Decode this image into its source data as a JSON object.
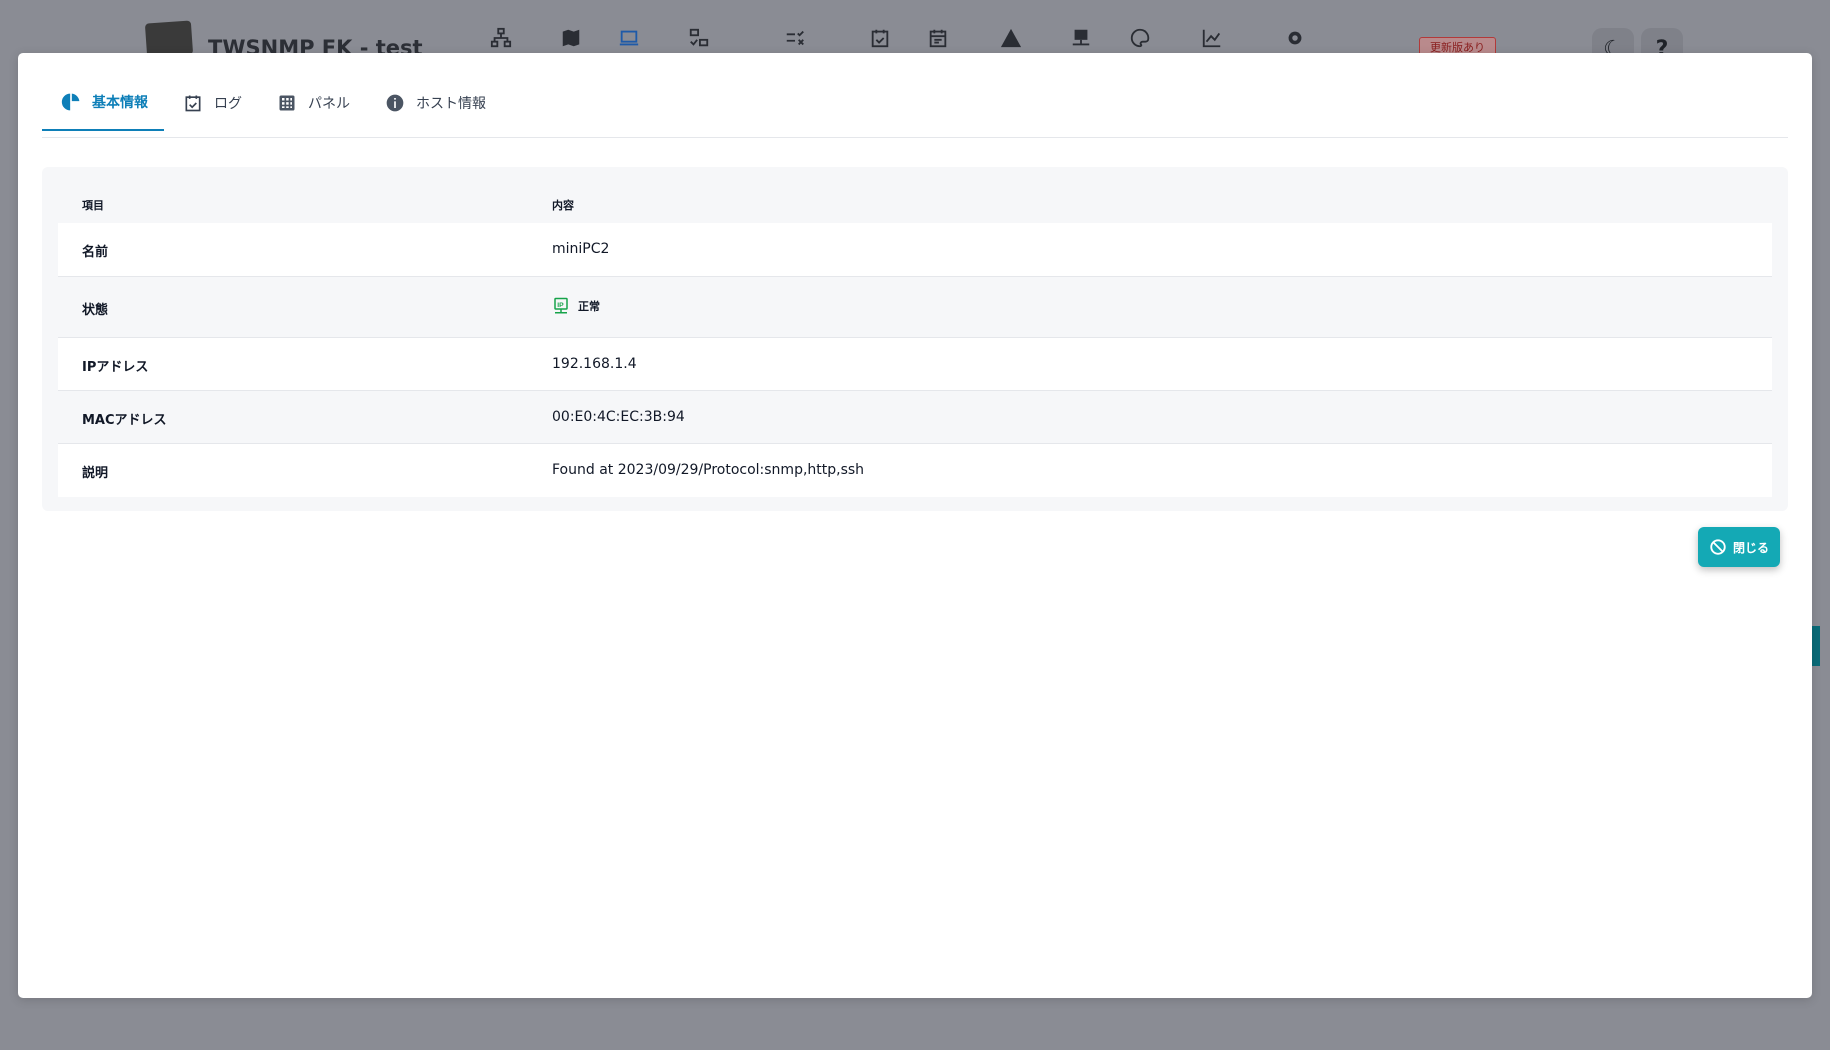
{
  "app": {
    "title": "TWSNMP FK - test",
    "update_badge": "更新版あり",
    "help_label": "?",
    "nav_icons": [
      "network-map-icon",
      "map-icon",
      "laptop-icon",
      "device-check-icon",
      "checklist-icon",
      "calendar-check-icon",
      "calendar-icon",
      "warning-icon",
      "network-node-icon",
      "palette-icon",
      "line-chart-icon",
      "gear-icon"
    ]
  },
  "tabs": [
    {
      "label": "基本情報",
      "icon": "pie-chart-icon",
      "active": true
    },
    {
      "label": "ログ",
      "icon": "calendar-check-icon",
      "active": false
    },
    {
      "label": "パネル",
      "icon": "grid-icon",
      "active": false
    },
    {
      "label": "ホスト情報",
      "icon": "info-icon",
      "active": false
    }
  ],
  "table": {
    "headers": {
      "item": "項目",
      "content": "内容"
    },
    "rows": {
      "name": {
        "label": "名前",
        "value": "miniPC2"
      },
      "status": {
        "label": "状態",
        "value": "正常",
        "color": "#16a34a"
      },
      "ip": {
        "label": "IPアドレス",
        "value": "192.168.1.4"
      },
      "mac": {
        "label": "MACアドレス",
        "value": "00:E0:4C:EC:3B:94"
      },
      "desc": {
        "label": "説明",
        "value": "Found at 2023/09/29/Protocol:snmp,http,ssh"
      }
    }
  },
  "close_button": {
    "label": "閉じる",
    "color": "#14a9b5"
  }
}
